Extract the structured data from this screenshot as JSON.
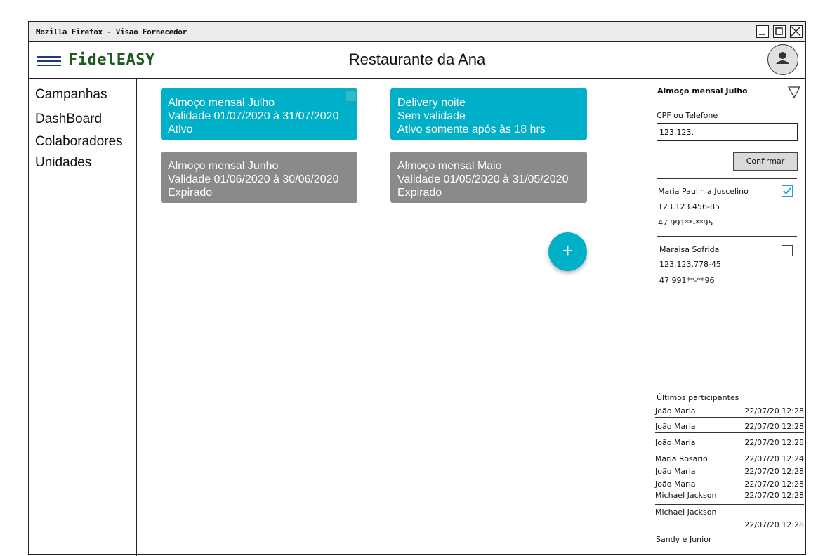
{
  "window": {
    "title": "Mozilla Firefox - Visão Fornecedor"
  },
  "header": {
    "logo": "FidelEASY",
    "title": "Restaurante da Ana"
  },
  "sidebar": {
    "items": [
      {
        "label": "Campanhas"
      },
      {
        "label": "DashBoard"
      },
      {
        "label": "Colaboradores"
      },
      {
        "label": "Unidades"
      }
    ]
  },
  "campaigns": [
    {
      "lines": [
        "Almoço mensal Julho",
        "Validade 01/07/2020 à 31/07/2020",
        "Ativo"
      ],
      "status": "active"
    },
    {
      "lines": [
        "Delivery noite",
        "Sem validade",
        "Ativo somente após às 18 hrs"
      ],
      "status": "active"
    },
    {
      "lines": [
        "Almoço mensal Junho",
        "Validade 01/06/2020 à 30/06/2020",
        "Expirado"
      ],
      "status": "expired"
    },
    {
      "lines": [
        "Almoço mensal Maio",
        "Validade 01/05/2020 à 31/05/2020",
        "Expirado"
      ],
      "status": "expired"
    }
  ],
  "fab": {
    "label": "+"
  },
  "panel": {
    "campaign": "Almoço mensal Julho",
    "field_label": "CPF ou Telefone",
    "field_value": "123.123.",
    "confirm_label": "Confirmar",
    "results": [
      {
        "name": "Maria Paulinia Juscelino",
        "cpf": "123.123.456-85",
        "phone": "47 991**-**95",
        "checked": true
      },
      {
        "name": "Maraisa Sofrida",
        "cpf": "123.123.778-45",
        "phone": "47 991**-**96",
        "checked": false
      }
    ],
    "last_title": "Últimos participantes",
    "participants": [
      {
        "name": "João Maria",
        "time": "22/07/20  12:28"
      },
      {
        "name": "João Maria",
        "time": "22/07/20  12:28"
      },
      {
        "name": "João Maria",
        "time": "22/07/20  12:28"
      },
      {
        "name": "Maria Rosario",
        "time": "22/07/20  12:24"
      },
      {
        "name": "João Maria",
        "time": "22/07/20  12:28"
      },
      {
        "name": "João Maria",
        "time": "22/07/20  12:28"
      },
      {
        "name": "Michael Jackson",
        "time": "22/07/20  12:28"
      },
      {
        "name": "Michael Jackson",
        "time": "22/07/20  12:28"
      },
      {
        "name": "Sandy e Junior",
        "time": ""
      }
    ]
  },
  "colors": {
    "accent": "#00b0c8",
    "expired": "#8a8a8a",
    "logo": "#1d5a1d"
  }
}
